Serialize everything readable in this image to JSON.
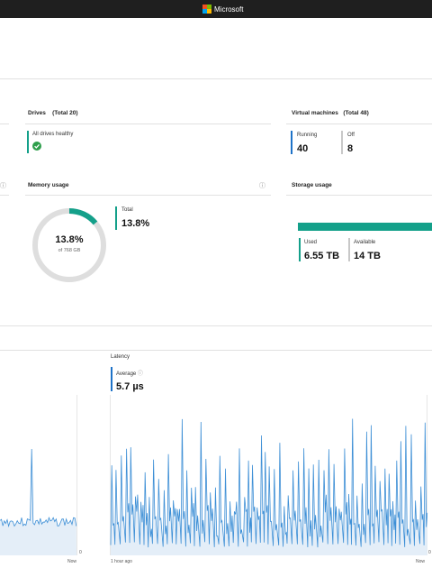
{
  "header": {
    "brand": "Microsoft"
  },
  "drives": {
    "title": "Drives",
    "total": "(Total 20)",
    "status": "All drives healthy"
  },
  "vms": {
    "title": "Virtual machines",
    "total": "(Total 48)",
    "running_label": "Running",
    "running_value": "40",
    "off_label": "Off",
    "off_value": "8"
  },
  "memory": {
    "title": "Memory usage",
    "percent": "13.8%",
    "of_total": "of 768 GB",
    "total_label": "Total",
    "total_value": "13.8%",
    "fraction": 0.138
  },
  "storage": {
    "title": "Storage usage",
    "used_label": "Used",
    "used_value": "6.55 TB",
    "available_label": "Available",
    "available_value": "14 TB"
  },
  "latency": {
    "title": "Latency",
    "average_label": "Average",
    "average_value": "5.7 µs",
    "x_start": "1 hour ago",
    "x_end": "Now",
    "y_min": "0"
  },
  "left_chart": {
    "x_end": "Now",
    "y_min": "0"
  },
  "colors": {
    "accent_blue": "#1e73c8",
    "teal": "#14a08a",
    "gray": "#c8c8c8",
    "chart_fill": "#e4eef8",
    "chart_line": "#3d8fd6"
  },
  "icons": {
    "info": "info-icon",
    "check": "check-circle-icon"
  }
}
